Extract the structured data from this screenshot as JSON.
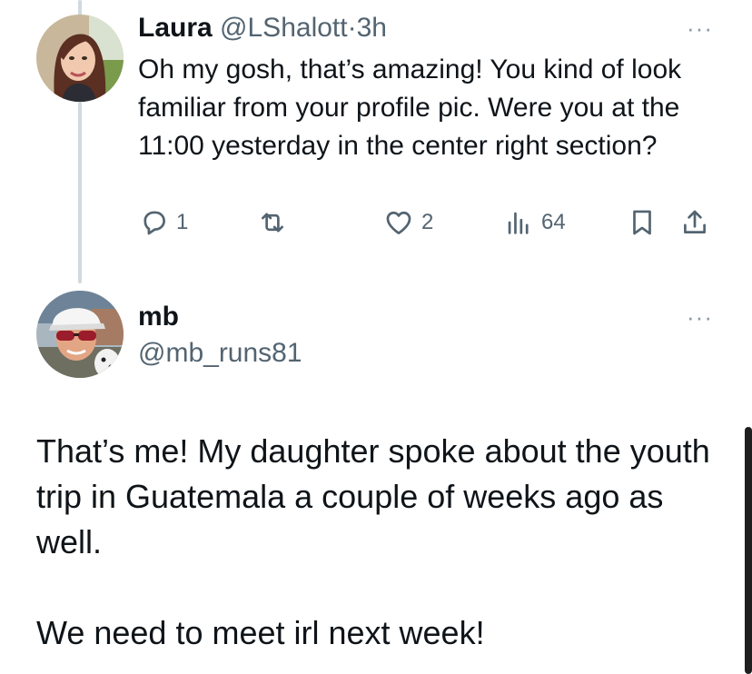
{
  "tweet1": {
    "author_name": "Laura",
    "handle": "@LShalott",
    "separator": "·",
    "time": "3h",
    "text": "Oh my gosh, that’s amazing! You kind of look familiar from your profile pic. Were you at the 11:00 yesterday in the center right section?",
    "actions": {
      "reply_icon": "reply-icon",
      "reply_count": "1",
      "retweet_icon": "retweet-icon",
      "like_icon": "heart-icon",
      "like_count": "2",
      "views_icon": "views-icon",
      "views_count": "64",
      "bookmark_icon": "bookmark-icon",
      "share_icon": "share-icon"
    },
    "more_icon": "more-icon",
    "more_glyph": "···"
  },
  "tweet2": {
    "author_name": "mb",
    "handle": "@mb_runs81",
    "more_glyph": "···",
    "paragraphs": [
      "That’s me! My daughter spoke about the youth trip in Guatemala a couple of weeks ago as well.",
      "We need to meet irl next week!"
    ]
  },
  "colors": {
    "text": "#0f1419",
    "muted": "#536471",
    "thread_line": "#cfd9de"
  }
}
